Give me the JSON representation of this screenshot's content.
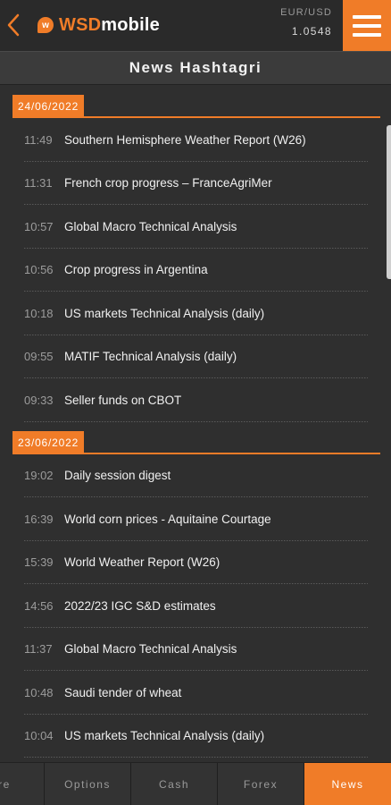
{
  "header": {
    "back_icon": "chevron-left-icon",
    "logo_mark": "w",
    "logo_wsd": "WSD",
    "logo_mobile": "mobile",
    "fx_pair": "EUR/USD",
    "fx_rate": "1.0548",
    "menu_icon": "hamburger-icon"
  },
  "title": "News Hashtagri",
  "colors": {
    "accent": "#f07c28",
    "background": "#2f2f2f"
  },
  "groups": [
    {
      "date": "24/06/2022",
      "items": [
        {
          "time": "11:49",
          "headline": "Southern Hemisphere Weather Report (W26)"
        },
        {
          "time": "11:31",
          "headline": "French crop progress – FranceAgriMer"
        },
        {
          "time": "10:57",
          "headline": "Global Macro Technical Analysis"
        },
        {
          "time": "10:56",
          "headline": "Crop progress in Argentina"
        },
        {
          "time": "10:18",
          "headline": "US markets Technical Analysis (daily)"
        },
        {
          "time": "09:55",
          "headline": "MATIF Technical Analysis (daily)"
        },
        {
          "time": "09:33",
          "headline": "Seller funds on CBOT"
        }
      ]
    },
    {
      "date": "23/06/2022",
      "items": [
        {
          "time": "19:02",
          "headline": "Daily session digest"
        },
        {
          "time": "16:39",
          "headline": "World corn prices - Aquitaine Courtage"
        },
        {
          "time": "15:39",
          "headline": "World Weather Report (W26)"
        },
        {
          "time": "14:56",
          "headline": "2022/23 IGC S&D estimates"
        },
        {
          "time": "11:37",
          "headline": "Global Macro Technical Analysis"
        },
        {
          "time": "10:48",
          "headline": "Saudi tender of wheat"
        },
        {
          "time": "10:04",
          "headline": "US markets Technical Analysis (daily)"
        }
      ]
    }
  ],
  "tabs": [
    {
      "label": "ure",
      "active": false
    },
    {
      "label": "Options",
      "active": false
    },
    {
      "label": "Cash",
      "active": false
    },
    {
      "label": "Forex",
      "active": false
    },
    {
      "label": "News",
      "active": true
    }
  ]
}
